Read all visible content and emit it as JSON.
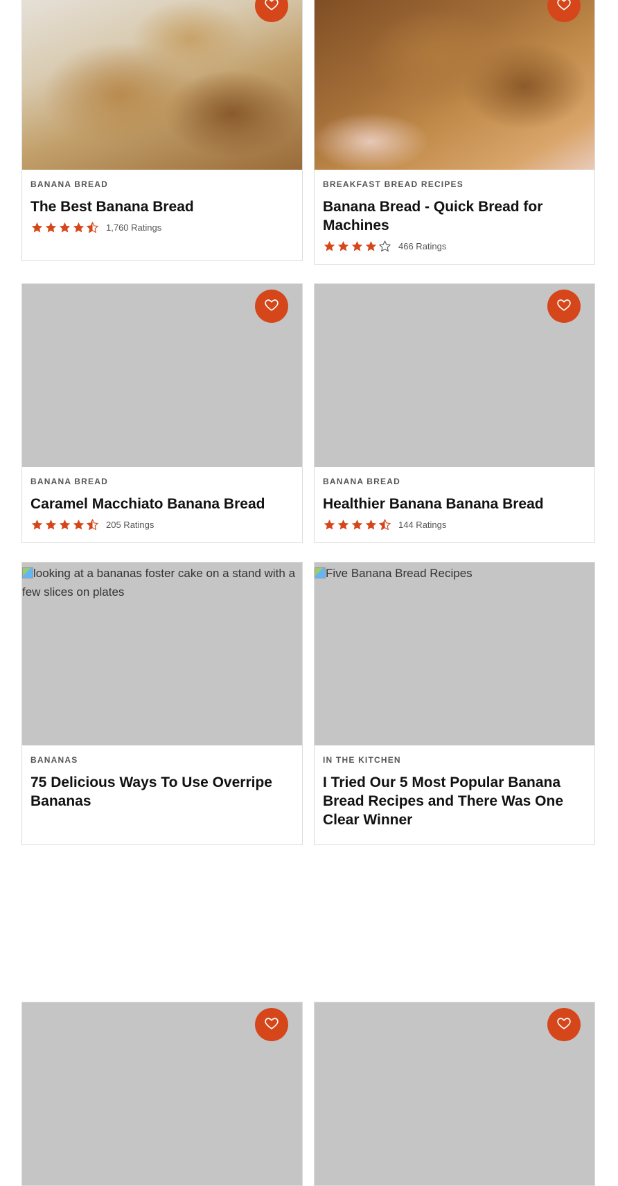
{
  "colors": {
    "accent": "#d5471b",
    "placeholder": "#c5c5c5",
    "card_border": "#dcdcdc"
  },
  "cards": [
    {
      "category": "BANANA BREAD",
      "title": "The Best Banana Bread",
      "rating": 4.5,
      "ratings_count": "1,760 Ratings",
      "image": "photo",
      "favorite_icon": "heart-icon"
    },
    {
      "category": "BREAKFAST BREAD RECIPES",
      "title": "Banana Bread - Quick Bread for Machines",
      "rating": 4,
      "ratings_count": "466 Ratings",
      "image": "photo",
      "favorite_icon": "heart-icon"
    },
    {
      "category": "BANANA BREAD",
      "title": "Caramel Macchiato Banana Bread",
      "rating": 4.5,
      "ratings_count": "205 Ratings",
      "image": "placeholder",
      "favorite_icon": "heart-icon"
    },
    {
      "category": "BANANA BREAD",
      "title": "Healthier Banana Banana Bread",
      "rating": 4.5,
      "ratings_count": "144 Ratings",
      "image": "placeholder",
      "favorite_icon": "heart-icon"
    },
    {
      "category": "BANANAS",
      "title": "75 Delicious Ways To Use Overripe Bananas",
      "image": "broken",
      "image_alt": "looking at a bananas foster cake on a stand with a few slices on plates"
    },
    {
      "category": "IN THE KITCHEN",
      "title": "I Tried Our 5 Most Popular Banana Bread Recipes and There Was One Clear Winner",
      "image": "broken",
      "image_alt": "Five Banana Bread Recipes"
    },
    {
      "image": "placeholder",
      "favorite_icon": "heart-icon"
    },
    {
      "image": "placeholder",
      "favorite_icon": "heart-icon"
    }
  ]
}
